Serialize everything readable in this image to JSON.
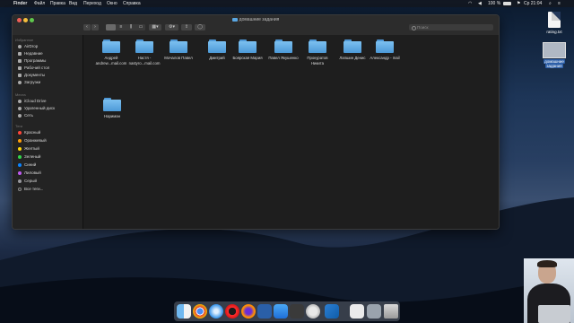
{
  "menubar": {
    "items": [
      "Finder",
      "Файл",
      "Правка",
      "Вид",
      "Переход",
      "Окно",
      "Справка"
    ],
    "battery": "100 %",
    "clock": "Ср 21:04"
  },
  "desktop": {
    "file1": "rating.txt",
    "file2_line1": "домашние",
    "file2_line2": "задания"
  },
  "window": {
    "title": "домашние задания",
    "search_placeholder": "Поиск"
  },
  "sidebar": {
    "favorites_header": "Избранное",
    "favorites": [
      "AirDrop",
      "Недавние",
      "Программы",
      "Рабочий стол",
      "Документы",
      "Загрузки"
    ],
    "places_header": "Места",
    "places": [
      "iCloud Drive",
      "Удаленный диск",
      "Сеть"
    ],
    "tags_header": "Теги",
    "tags": [
      {
        "label": "Красный",
        "color": "#ff453a"
      },
      {
        "label": "Оранжевый",
        "color": "#ff9f0a"
      },
      {
        "label": "Желтый",
        "color": "#ffd60a"
      },
      {
        "label": "Зеленый",
        "color": "#32d74b"
      },
      {
        "label": "Синий",
        "color": "#0a84ff"
      },
      {
        "label": "Лиловый",
        "color": "#bf5af2"
      },
      {
        "label": "Серый",
        "color": "#98989d"
      }
    ],
    "all_tags": "Все теги..."
  },
  "folders": [
    {
      "line1": "Андрей",
      "line2": "andrew...mail.com"
    },
    {
      "line1": "Настя -",
      "line2": "nastyro...mail.com"
    },
    {
      "line1": "Мочалов Павел",
      "line2": ""
    },
    {
      "line1": "Дмитрий",
      "line2": ""
    },
    {
      "line1": "Боярская Мария",
      "line2": ""
    },
    {
      "line1": "Павел Якушенко",
      "line2": ""
    },
    {
      "line1": "Прокуратов",
      "line2": "Никита"
    },
    {
      "line1": "Лапшин Денис",
      "line2": ""
    },
    {
      "line1": "Александр - mail",
      "line2": ""
    },
    {
      "line1": "Нариман",
      "line2": ""
    }
  ]
}
